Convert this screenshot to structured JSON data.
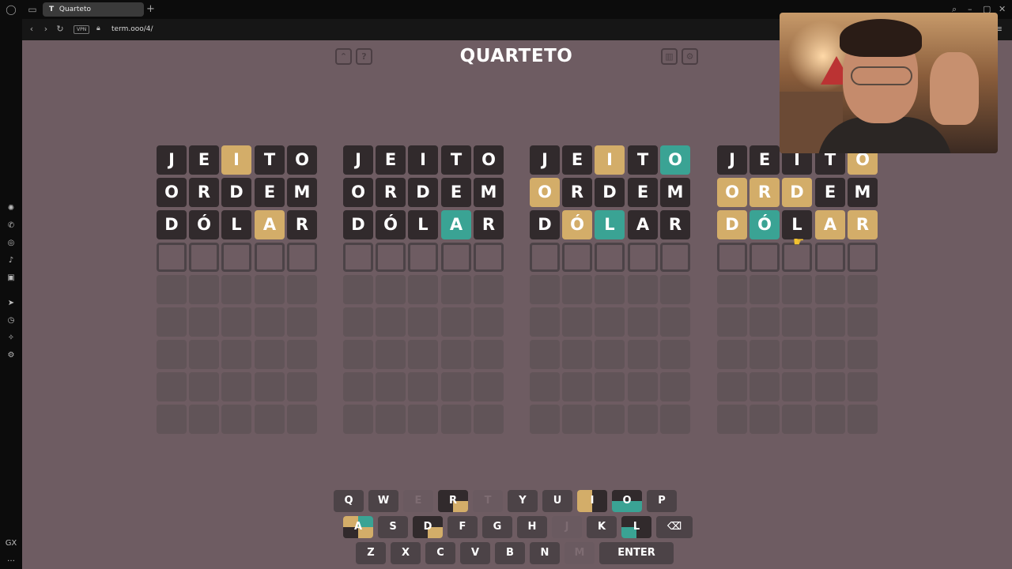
{
  "browser": {
    "tab_title": "Quarteto",
    "tab_favicon": "T",
    "new_tab": "+",
    "url": "term.ooo/4/",
    "vpn_badge": "VPN"
  },
  "game": {
    "title": "QUARTETO",
    "buttons": {
      "collapse_icon": "chevron-up-icon",
      "help_label": "?",
      "stats_icon": "bar-chart-icon",
      "settings_icon": "gear-icon"
    },
    "colors": {
      "background": "#6e5c62",
      "wrong": "#312a2c",
      "misplaced": "#d3ad69",
      "correct": "#3aa394"
    },
    "boards": [
      {
        "rows": [
          {
            "letters": [
              "J",
              "E",
              "I",
              "T",
              "O"
            ],
            "states": [
              "wrong",
              "wrong",
              "place",
              "wrong",
              "wrong"
            ]
          },
          {
            "letters": [
              "O",
              "R",
              "D",
              "E",
              "M"
            ],
            "states": [
              "wrong",
              "wrong",
              "wrong",
              "wrong",
              "wrong"
            ]
          },
          {
            "letters": [
              "D",
              "Ó",
              "L",
              "A",
              "R"
            ],
            "states": [
              "wrong",
              "wrong",
              "wrong",
              "place",
              "wrong"
            ]
          }
        ]
      },
      {
        "rows": [
          {
            "letters": [
              "J",
              "E",
              "I",
              "T",
              "O"
            ],
            "states": [
              "wrong",
              "wrong",
              "wrong",
              "wrong",
              "wrong"
            ]
          },
          {
            "letters": [
              "O",
              "R",
              "D",
              "E",
              "M"
            ],
            "states": [
              "wrong",
              "wrong",
              "wrong",
              "wrong",
              "wrong"
            ]
          },
          {
            "letters": [
              "D",
              "Ó",
              "L",
              "A",
              "R"
            ],
            "states": [
              "wrong",
              "wrong",
              "wrong",
              "right",
              "wrong"
            ]
          }
        ]
      },
      {
        "rows": [
          {
            "letters": [
              "J",
              "E",
              "I",
              "T",
              "O"
            ],
            "states": [
              "wrong",
              "wrong",
              "place",
              "wrong",
              "right"
            ]
          },
          {
            "letters": [
              "O",
              "R",
              "D",
              "E",
              "M"
            ],
            "states": [
              "place",
              "wrong",
              "wrong",
              "wrong",
              "wrong"
            ]
          },
          {
            "letters": [
              "D",
              "Ó",
              "L",
              "A",
              "R"
            ],
            "states": [
              "wrong",
              "place",
              "right",
              "wrong",
              "wrong"
            ]
          }
        ]
      },
      {
        "rows": [
          {
            "letters": [
              "J",
              "E",
              "I",
              "T",
              "O"
            ],
            "states": [
              "wrong",
              "wrong",
              "wrong",
              "wrong",
              "place"
            ]
          },
          {
            "letters": [
              "O",
              "R",
              "D",
              "E",
              "M"
            ],
            "states": [
              "place",
              "place",
              "place",
              "wrong",
              "wrong"
            ]
          },
          {
            "letters": [
              "D",
              "Ó",
              "L",
              "A",
              "R"
            ],
            "states": [
              "place",
              "right",
              "wrong",
              "place",
              "place"
            ]
          }
        ]
      }
    ],
    "keyboard": {
      "row1": [
        "Q",
        "W",
        "E",
        "R",
        "T",
        "Y",
        "U",
        "I",
        "O",
        "P"
      ],
      "row2": [
        "A",
        "S",
        "D",
        "F",
        "G",
        "H",
        "J",
        "K",
        "L"
      ],
      "row3": [
        "Z",
        "X",
        "C",
        "V",
        "B",
        "N",
        "M"
      ],
      "enter_label": "ENTER",
      "backspace_icon": "backspace-icon"
    }
  }
}
